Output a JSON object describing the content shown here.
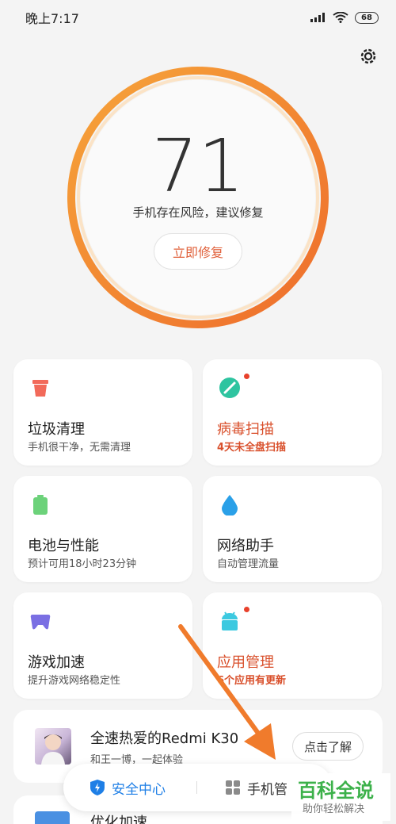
{
  "status": {
    "time": "晚上7:17",
    "battery": "68"
  },
  "score": {
    "value": "71",
    "description": "手机存在风险，建议修复",
    "fix_label": "立即修复",
    "ring_color": "#f18a36"
  },
  "cards": [
    {
      "title": "垃圾清理",
      "subtitle": "手机很干净，无需清理",
      "icon": "trash-icon",
      "alert": false
    },
    {
      "title": "病毒扫描",
      "subtitle": "4天未全盘扫描",
      "icon": "virus-scan-icon",
      "alert": true
    },
    {
      "title": "电池与性能",
      "subtitle": "预计可用18小时23分钟",
      "icon": "battery-icon",
      "alert": false
    },
    {
      "title": "网络助手",
      "subtitle": "自动管理流量",
      "icon": "water-drop-icon",
      "alert": false
    },
    {
      "title": "游戏加速",
      "subtitle": "提升游戏网络稳定性",
      "icon": "gamepad-icon",
      "alert": false
    },
    {
      "title": "应用管理",
      "subtitle": "6个应用有更新",
      "icon": "android-icon",
      "alert": true
    }
  ],
  "promo": {
    "title": "全速热爱的Redmi K30",
    "subtitle": "和王一博，一起体验",
    "button": "点击了解"
  },
  "next_card": {
    "title": "优化加速"
  },
  "bottom_bar": {
    "security_label": "安全中心",
    "phone_label": "手机管"
  },
  "watermark": {
    "title": "百科全说",
    "subtitle": "助你轻松解决"
  },
  "colors": {
    "accent": "#e0603a",
    "alert": "#d9502c",
    "tab_active": "#1f7fe6",
    "arrow": "#f07b2c"
  }
}
